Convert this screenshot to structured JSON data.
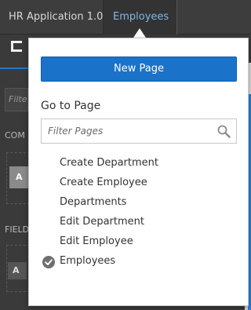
{
  "header": {
    "app_name": "HR Application 1.0",
    "breadcrumb_current": "Employees"
  },
  "background": {
    "filter_hint": "Filte",
    "section_comp": "COM",
    "section_fields": "FIELD",
    "chip_a": "A",
    "chip_a2": "A"
  },
  "popup": {
    "new_page_label": "New Page",
    "goto_heading": "Go to Page",
    "search_placeholder": "Filter Pages",
    "search_icon": "search-icon",
    "pages": [
      {
        "label": "Create Department",
        "selected": false
      },
      {
        "label": "Create Employee",
        "selected": false
      },
      {
        "label": "Departments",
        "selected": false
      },
      {
        "label": "Edit Department",
        "selected": false
      },
      {
        "label": "Edit Employee",
        "selected": false
      },
      {
        "label": "Employees",
        "selected": true
      }
    ]
  },
  "colors": {
    "accent": "#1a73c8",
    "breadcrumb_link": "#7fb8e8",
    "topbar": "#3d3d3d",
    "check": "#6e6e6e"
  }
}
